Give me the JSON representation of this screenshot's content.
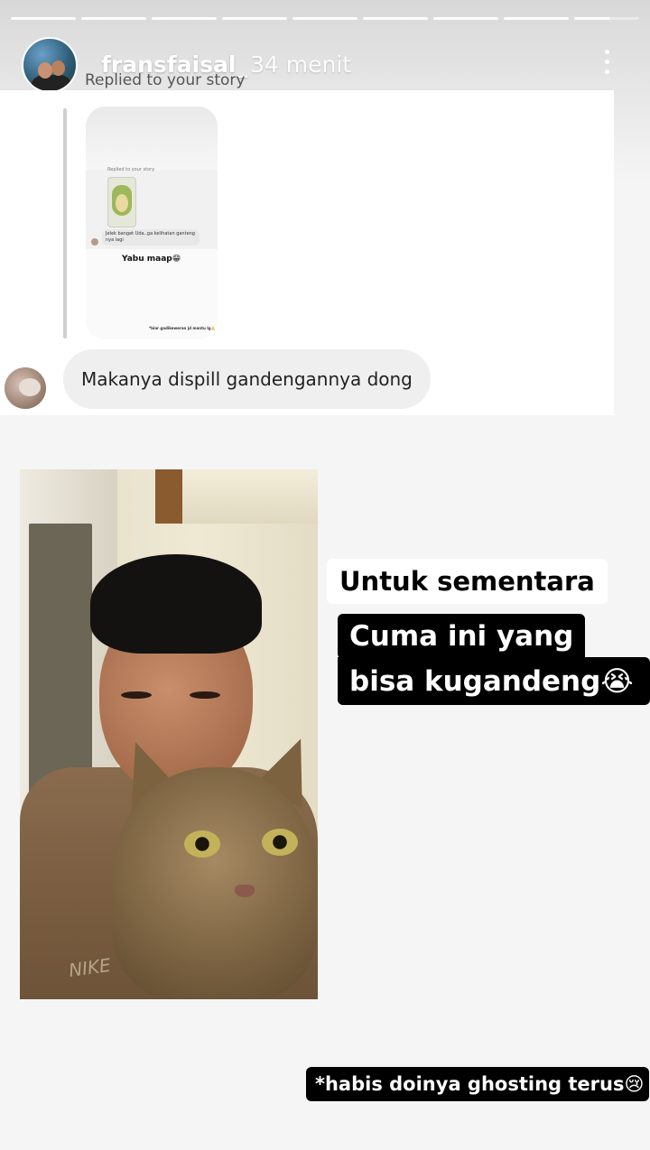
{
  "header": {
    "username": "fransfaisal_",
    "time": "34 menit",
    "replied_label": "Replied to your story",
    "progress_segments": 9
  },
  "dm": {
    "mini_replied_label": "Replied to your story",
    "mini_reply_text": "Jelek banget Uda..ga kelihatan ganteng nya lagi",
    "mini_caption": "Yabu maap😁",
    "mini_footer": "*biar gadikeweran jd mantu lg🙏",
    "reply_text": "Makanya dispill gandengannya dong"
  },
  "stickers": {
    "line1": "Untuk sementara",
    "line2": "Cuma ini yang",
    "line3": "bisa kugandeng😭",
    "footnote": "*habis doinya ghosting terus😢"
  },
  "photo": {
    "shirt_logo": "NIKE"
  }
}
